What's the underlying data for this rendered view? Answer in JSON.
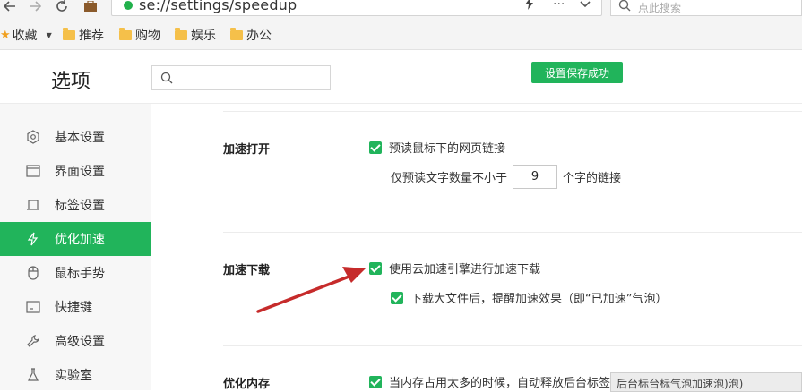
{
  "browser": {
    "url": "se://settings/speedup",
    "search_placeholder": "点此搜索",
    "bookmarks": {
      "favorites": "收藏",
      "folders": [
        "推荐",
        "购物",
        "娱乐",
        "办公"
      ]
    }
  },
  "header": {
    "title": "选项",
    "toast": "设置保存成功"
  },
  "sidebar": {
    "items": [
      {
        "label": "基本设置",
        "icon": "gear-icon"
      },
      {
        "label": "界面设置",
        "icon": "window-icon"
      },
      {
        "label": "标签设置",
        "icon": "tab-icon"
      },
      {
        "label": "优化加速",
        "icon": "lightning-icon",
        "active": true
      },
      {
        "label": "鼠标手势",
        "icon": "mouse-icon"
      },
      {
        "label": "快捷键",
        "icon": "keyboard-icon"
      },
      {
        "label": "高级设置",
        "icon": "wrench-icon"
      },
      {
        "label": "实验室",
        "icon": "flask-icon"
      }
    ]
  },
  "sections": {
    "open": {
      "title": "加速打开",
      "preread_label": "预读鼠标下的网页链接",
      "min_chars_prefix": "仅预读文字数量不小于",
      "min_chars_value": "9",
      "min_chars_suffix": "个字的链接"
    },
    "download": {
      "title": "加速下载",
      "cloud_label": "使用云加速引擎进行加速下载",
      "bubble_label": "下载大文件后，提醒加速效果（即“已加速”气泡）"
    },
    "memory": {
      "title": "优化内存",
      "release_label": "当内存占用太多的时候，自动释放后台标签"
    }
  },
  "tooltip_text": "后台标台标气泡加速泡)泡)",
  "colors": {
    "accent": "#21b45b",
    "arrow": "#c62b2b"
  }
}
